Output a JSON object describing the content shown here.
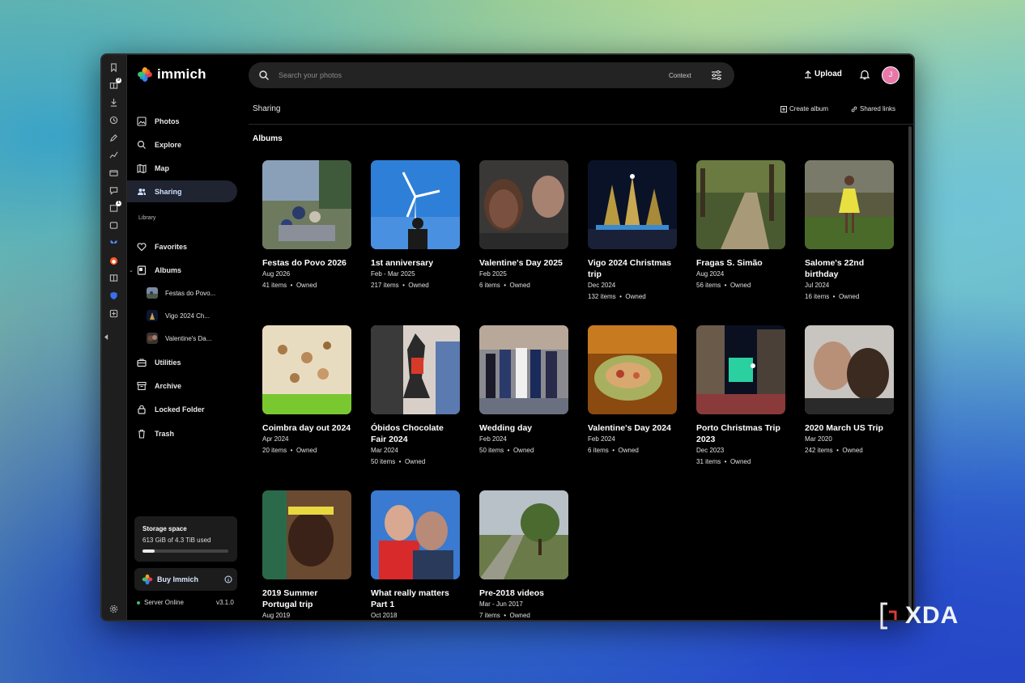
{
  "app": {
    "name": "immich",
    "logo_icon": "immich-pinwheel-logo"
  },
  "search": {
    "placeholder": "Search your photos",
    "context_label": "Context"
  },
  "header": {
    "upload_label": "Upload",
    "avatar_initial": "J"
  },
  "rail": {
    "icons": [
      "bookmark-icon",
      "gift-icon",
      "download-icon",
      "history-icon",
      "edit-icon",
      "stats-icon",
      "wallet-icon",
      "chat-icon",
      "share-icon",
      "window-icon",
      "bluesky-icon",
      "reddit-icon",
      "book-icon",
      "shield-icon",
      "add-icon",
      "collapse-icon",
      "settings-icon"
    ],
    "badges": [
      "9",
      "1"
    ]
  },
  "sidebar": {
    "items": [
      {
        "label": "Photos",
        "icon": "photos-icon"
      },
      {
        "label": "Explore",
        "icon": "search-icon"
      },
      {
        "label": "Map",
        "icon": "map-icon"
      },
      {
        "label": "Sharing",
        "icon": "people-icon",
        "active": true
      }
    ],
    "library_label": "Library",
    "library_items": [
      {
        "label": "Favorites",
        "icon": "heart-icon"
      },
      {
        "label": "Albums",
        "icon": "album-icon"
      }
    ],
    "album_children": [
      "Festas do Povo...",
      "Vigo 2024 Ch...",
      "Valentine's Da..."
    ],
    "bottom_items": [
      {
        "label": "Utilities",
        "icon": "briefcase-icon"
      },
      {
        "label": "Archive",
        "icon": "archive-icon"
      },
      {
        "label": "Locked Folder",
        "icon": "lock-icon"
      },
      {
        "label": "Trash",
        "icon": "trash-icon"
      }
    ],
    "storage": {
      "title": "Storage space",
      "usage": "613 GiB of 4.3 TiB used",
      "fraction": 0.14
    },
    "buy_label": "Buy Immich",
    "server_status": "Server Online",
    "version": "v3.1.0"
  },
  "main": {
    "breadcrumb": "Sharing",
    "create_album": "Create album",
    "shared_links": "Shared links",
    "section_title": "Albums",
    "albums": [
      {
        "title": "Festas do Povo 2026",
        "date": "Aug 2026",
        "items": "41 items",
        "owner": "Owned"
      },
      {
        "title": "1st anniversary",
        "date": "Feb - Mar 2025",
        "items": "217 items",
        "owner": "Owned"
      },
      {
        "title": "Valentine's Day 2025",
        "date": "Feb 2025",
        "items": "6 items",
        "owner": "Owned"
      },
      {
        "title": "Vigo 2024 Christmas trip",
        "date": "Dec 2024",
        "items": "132 items",
        "owner": "Owned"
      },
      {
        "title": "Fragas S. Simão",
        "date": "Aug 2024",
        "items": "56 items",
        "owner": "Owned"
      },
      {
        "title": "Salome's 22nd birthday",
        "date": "Jul 2024",
        "items": "16 items",
        "owner": "Owned"
      },
      {
        "title": "Coimbra day out 2024",
        "date": "Apr 2024",
        "items": "20 items",
        "owner": "Owned"
      },
      {
        "title": "Óbidos Chocolate Fair 2024",
        "date": "Mar 2024",
        "items": "50 items",
        "owner": "Owned"
      },
      {
        "title": "Wedding day",
        "date": "Feb 2024",
        "items": "50 items",
        "owner": "Owned"
      },
      {
        "title": "Valentine's Day 2024",
        "date": "Feb 2024",
        "items": "6 items",
        "owner": "Owned"
      },
      {
        "title": "Porto Christmas Trip 2023",
        "date": "Dec 2023",
        "items": "31 items",
        "owner": "Owned"
      },
      {
        "title": "2020 March US Trip",
        "date": "Mar 2020",
        "items": "242 items",
        "owner": "Owned"
      },
      {
        "title": "2019 Summer Portugal trip",
        "date": "Aug 2019",
        "items": "",
        "owner": ""
      },
      {
        "title": "What really matters Part 1",
        "date": "Oct 2018",
        "items": "",
        "owner": ""
      },
      {
        "title": "Pre-2018 videos",
        "date": "Mar - Jun 2017",
        "items": "7 items",
        "owner": "Owned"
      }
    ]
  },
  "watermark": {
    "text": "XDA"
  }
}
